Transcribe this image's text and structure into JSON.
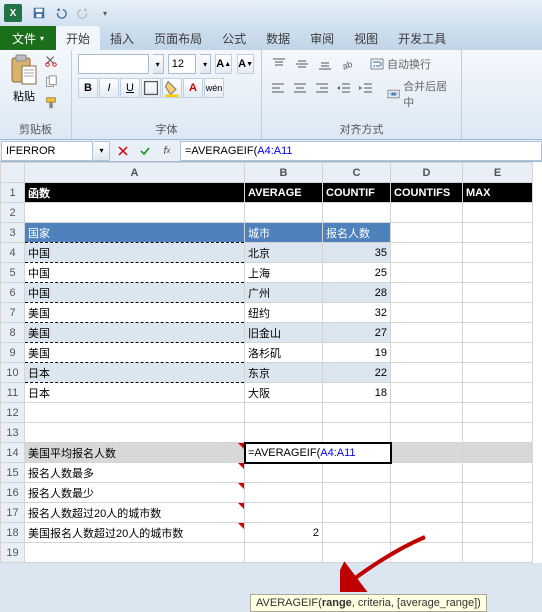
{
  "qat": {
    "app": "X"
  },
  "tabs": {
    "file": "文件",
    "items": [
      "开始",
      "插入",
      "页面布局",
      "公式",
      "数据",
      "审阅",
      "视图",
      "开发工具"
    ],
    "active": 0
  },
  "ribbon": {
    "clipboard": {
      "paste": "粘贴",
      "label": "剪贴板"
    },
    "font": {
      "size": "12",
      "b": "B",
      "i": "I",
      "u": "U",
      "label": "字体"
    },
    "align": {
      "wrap": "自动换行",
      "merge": "合并后居中",
      "label": "对齐方式"
    }
  },
  "formula_bar": {
    "name_box": "IFERROR",
    "formula_prefix": "=AVERAGEIF(",
    "formula_range": "A4:A11"
  },
  "columns": [
    "A",
    "B",
    "C",
    "D",
    "E"
  ],
  "rows": {
    "r1": {
      "A": "函数",
      "B": "AVERAGE",
      "C": "COUNTIF",
      "D": "COUNTIFS",
      "E": "MAX"
    },
    "r3": {
      "A": "国家",
      "B": "城市",
      "C": "报名人数"
    },
    "data": [
      {
        "A": "中国",
        "B": "北京",
        "C": 35
      },
      {
        "A": "中国",
        "B": "上海",
        "C": 25
      },
      {
        "A": "中国",
        "B": "广州",
        "C": 28
      },
      {
        "A": "美国",
        "B": "纽约",
        "C": 32
      },
      {
        "A": "美国",
        "B": "旧金山",
        "C": 27
      },
      {
        "A": "美国",
        "B": "洛杉矶",
        "C": 19
      },
      {
        "A": "日本",
        "B": "东京",
        "C": 22
      },
      {
        "A": "日本",
        "B": "大阪",
        "C": 18
      }
    ],
    "r14": {
      "A": "美国平均报名人数",
      "B_prefix": "=AVERAGEIF(",
      "B_range": "A4:A11"
    },
    "r15": {
      "A": "报名人数最多"
    },
    "r16": {
      "A": "报名人数最少"
    },
    "r17": {
      "A": "报名人数超过20人的城市数"
    },
    "r18": {
      "A": "美国报名人数超过20人的城市数",
      "B": 2
    }
  },
  "tooltip": {
    "fn": "AVERAGEIF",
    "sig_bold": "range",
    "sig_rest": ", criteria, [average_range])"
  }
}
